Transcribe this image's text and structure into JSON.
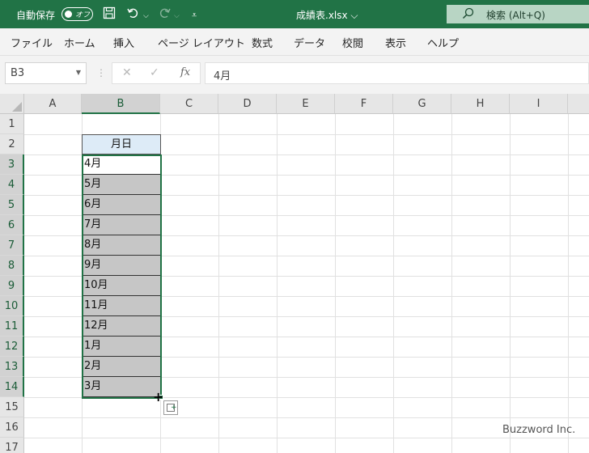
{
  "titlebar": {
    "autosave_label": "自動保存",
    "autosave_state": "オフ",
    "file_title": "成績表.xlsx ⌵",
    "search_placeholder": "検索 (Alt+Q)"
  },
  "ribbon": {
    "tabs": [
      "ファイル",
      "ホーム",
      "挿入",
      "ページ レイアウト",
      "数式",
      "データ",
      "校閲",
      "表示",
      "ヘルプ"
    ]
  },
  "formula_bar": {
    "name_box": "B3",
    "fx": "fx",
    "formula": "4月"
  },
  "sheet": {
    "columns": [
      "A",
      "B",
      "C",
      "D",
      "E",
      "F",
      "G",
      "H",
      "I"
    ],
    "active_column": "B",
    "rows": [
      "1",
      "2",
      "3",
      "4",
      "5",
      "6",
      "7",
      "8",
      "9",
      "10",
      "11",
      "12",
      "13",
      "14",
      "15",
      "16",
      "17"
    ],
    "active_rows": [
      "3",
      "4",
      "5",
      "6",
      "7",
      "8",
      "9",
      "10",
      "11",
      "12",
      "13",
      "14"
    ],
    "b2_header": "月日",
    "b_values": [
      "4月",
      "5月",
      "6月",
      "7月",
      "8月",
      "9月",
      "10月",
      "11月",
      "12月",
      "1月",
      "2月",
      "3月"
    ]
  },
  "watermark": "Buzzword Inc."
}
